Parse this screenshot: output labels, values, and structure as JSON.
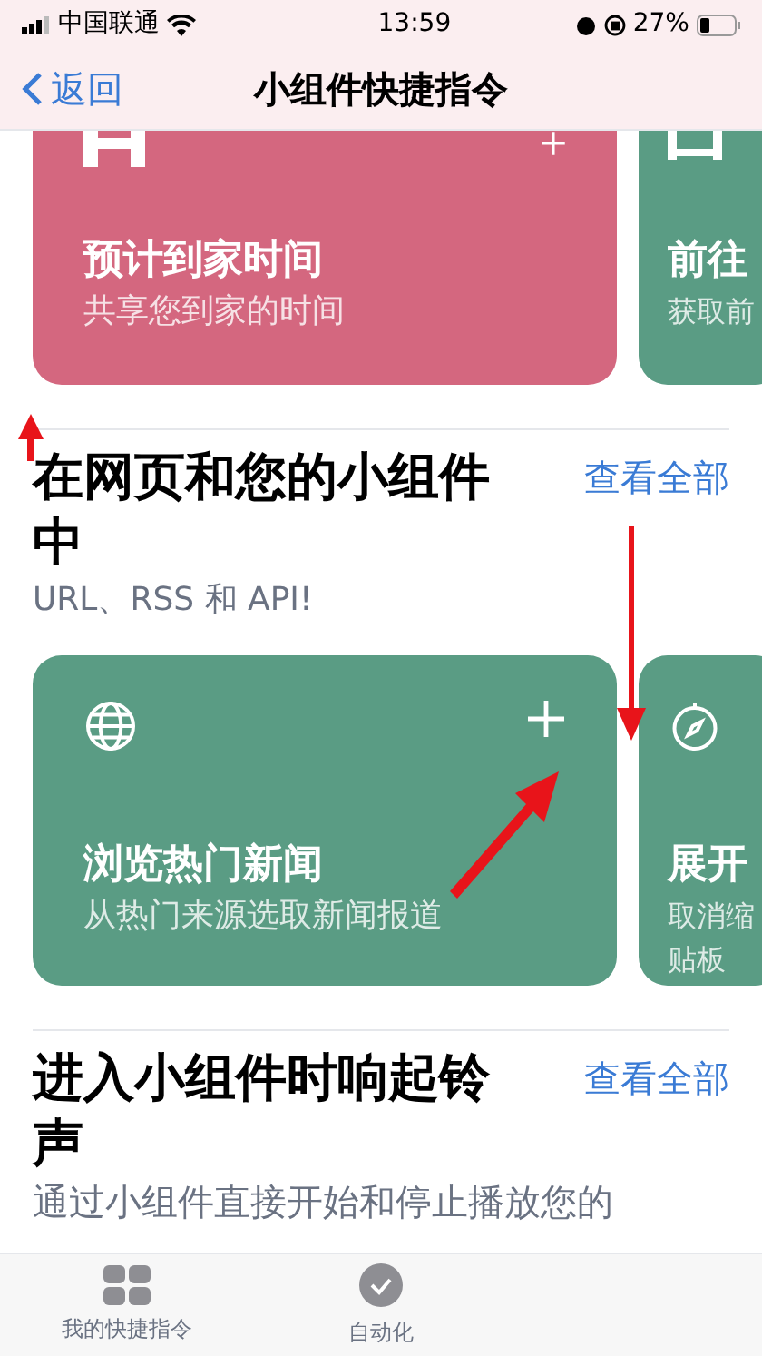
{
  "status_bar": {
    "carrier": "中国联通",
    "time": "13:59",
    "battery": "27%"
  },
  "nav": {
    "back": "返回",
    "title": "小组件快捷指令"
  },
  "top_cards": [
    {
      "title": "预计到家时间",
      "lines": [
        "共享您到家的时间"
      ],
      "color": "#d4677f"
    },
    {
      "title": "前往",
      "lines": [
        "获取前"
      ],
      "color": "#5a9c84"
    }
  ],
  "sections": [
    {
      "title": "在网页和您的小组件中",
      "link": "查看全部",
      "subtitle": "URL、RSS 和 API!",
      "cards": [
        {
          "title": "浏览热门新闻",
          "lines": [
            "从热门来源选取新闻报道"
          ],
          "color": "#5a9c84"
        },
        {
          "title": "展开",
          "lines": [
            "取消缩",
            "贴板"
          ],
          "color": "#5a9c84"
        }
      ]
    },
    {
      "title": "进入小组件时响起铃声",
      "link": "查看全部",
      "subtitle": "通过小组件直接开始和停止播放您的"
    }
  ],
  "tab_bar": [
    {
      "label": "我的快捷指令",
      "selected": false
    },
    {
      "label": "自动化",
      "selected": false
    }
  ]
}
